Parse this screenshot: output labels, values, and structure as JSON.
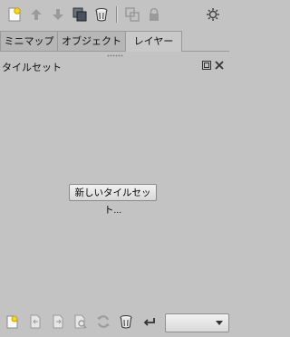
{
  "toolbar": {
    "icons": [
      "new-layer-icon",
      "move-up-icon",
      "move-down-icon",
      "duplicate-icon",
      "delete-icon",
      "merge-icon",
      "lock-icon",
      "settings-icon"
    ]
  },
  "tabs": [
    {
      "label": "ミニマップ",
      "active": false
    },
    {
      "label": "オブジェクト",
      "active": false
    },
    {
      "label": "レイヤー",
      "active": true
    }
  ],
  "panel": {
    "title": "タイルセット",
    "new_tileset_button": "新しいタイルセット..."
  },
  "bottombar": {
    "icons": [
      "new-tileset-icon",
      "import-icon",
      "export-icon",
      "edit-tileset-icon",
      "refresh-icon",
      "delete-icon",
      "back-icon"
    ],
    "select_value": ""
  }
}
